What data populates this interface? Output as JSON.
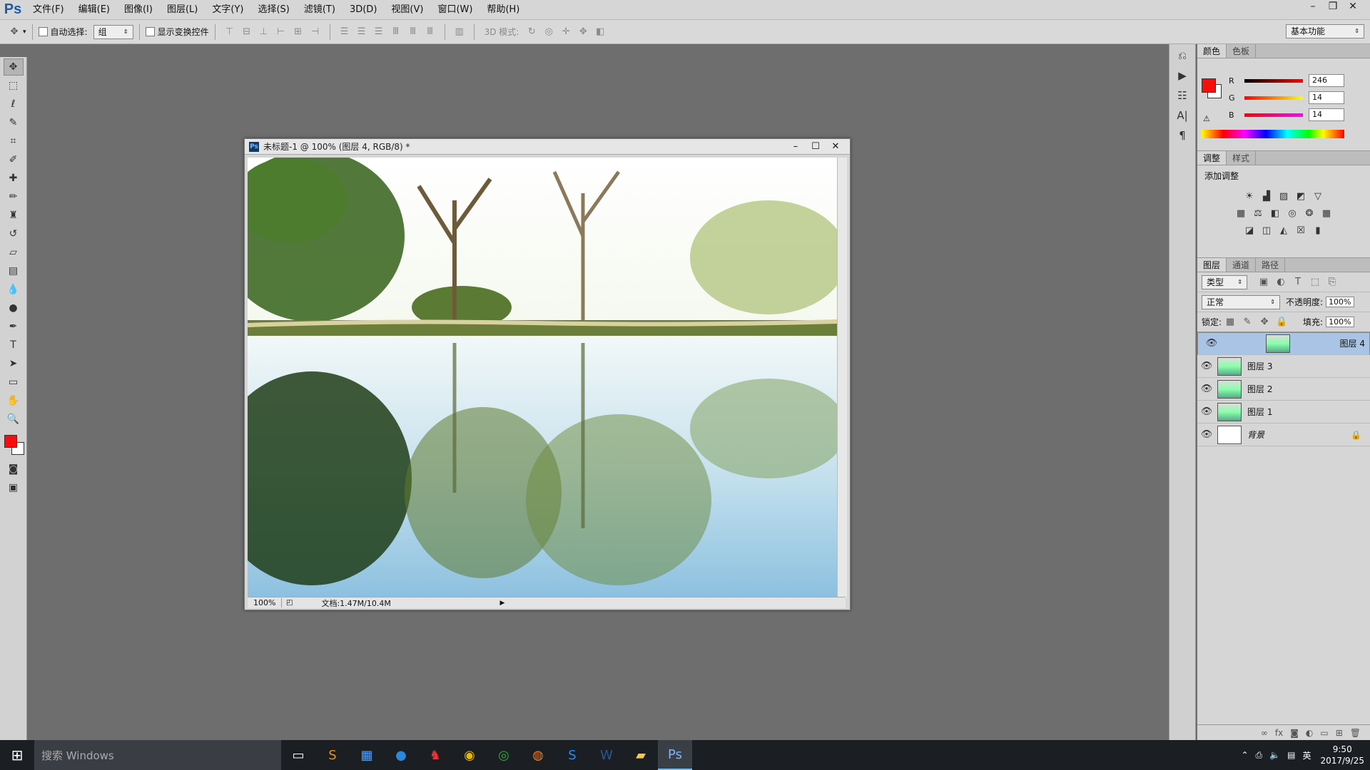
{
  "app": {
    "logo": "Ps"
  },
  "menu": [
    "文件(F)",
    "编辑(E)",
    "图像(I)",
    "图层(L)",
    "文字(Y)",
    "选择(S)",
    "滤镜(T)",
    "3D(D)",
    "视图(V)",
    "窗口(W)",
    "帮助(H)"
  ],
  "options": {
    "auto_select_label": "自动选择:",
    "auto_select_value": "组",
    "show_transform_label": "显示变换控件",
    "mode3d_label": "3D 模式:",
    "workspace": "基本功能"
  },
  "document": {
    "title": "未标题-1 @ 100% (图层 4, RGB/8) *",
    "zoom": "100%",
    "doc_info": "文档:1.47M/10.4M"
  },
  "color_panel": {
    "tabs": [
      "颜色",
      "色板"
    ],
    "r_label": "R",
    "g_label": "G",
    "b_label": "B",
    "r": "246",
    "g": "14",
    "b": "14",
    "fg_color": "#f60e0e"
  },
  "adjust_panel": {
    "tabs": [
      "调整",
      "样式"
    ],
    "title": "添加调整"
  },
  "layers_panel": {
    "tabs": [
      "图层",
      "通道",
      "路径"
    ],
    "filter": "类型",
    "blend_mode": "正常",
    "opacity_label": "不透明度:",
    "opacity": "100%",
    "lock_label": "锁定:",
    "fill_label": "填充:",
    "fill": "100%",
    "layers": [
      {
        "name": "图层 4",
        "selected": true
      },
      {
        "name": "图层 3",
        "selected": false
      },
      {
        "name": "图层 2",
        "selected": false
      },
      {
        "name": "图层 1",
        "selected": false
      },
      {
        "name": "背景",
        "selected": false,
        "locked": true
      }
    ]
  },
  "taskbar": {
    "search_placeholder": "搜索 Windows",
    "time": "9:50",
    "date": "2017/9/25",
    "lang": "英"
  }
}
